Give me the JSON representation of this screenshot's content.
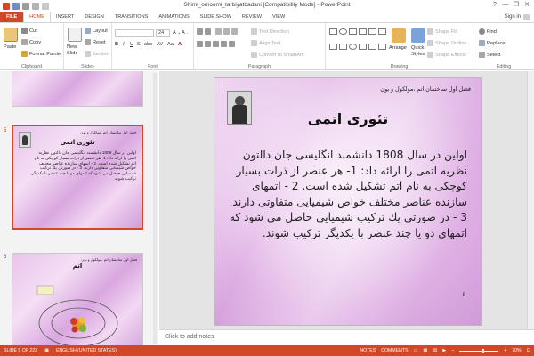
{
  "window": {
    "title": "Shimi_omoomi_tarbiyatbadani [Compatibility Mode] - PowerPoint",
    "minimize": "—",
    "restore": "❐",
    "close": "✕",
    "help": "?"
  },
  "tabs": [
    {
      "label": "FILE"
    },
    {
      "label": "HOME"
    },
    {
      "label": "INSERT"
    },
    {
      "label": "DESIGN"
    },
    {
      "label": "TRANSITIONS"
    },
    {
      "label": "ANIMATIONS"
    },
    {
      "label": "SLIDE SHOW"
    },
    {
      "label": "REVIEW"
    },
    {
      "label": "VIEW"
    }
  ],
  "account": {
    "signin": "Sign in"
  },
  "ribbon": {
    "clipboard": {
      "paste": "Paste",
      "cut": "Cut",
      "copy": "Copy",
      "format_painter": "Format Painter",
      "label": "Clipboard"
    },
    "slides": {
      "new_slide": "New",
      "new_slide2": "Slide",
      "layout": "Layout",
      "reset": "Reset",
      "section": "Section",
      "label": "Slides"
    },
    "font": {
      "size": "24",
      "bold": "B",
      "italic": "I",
      "underline": "U",
      "strike": "S",
      "abc": "abc",
      "av": "AV",
      "aa": "Aa",
      "fontcolor": "A",
      "label": "Font"
    },
    "paragraph": {
      "text_direction": "Text Direction",
      "align_text": "Align Text",
      "smartart": "Convert to SmartArt",
      "label": "Paragraph"
    },
    "drawing": {
      "arrange": "Arrange",
      "quick_styles": "Quick",
      "quick_styles2": "Styles",
      "shape_fill": "Shape Fill",
      "shape_outline": "Shape Outline",
      "shape_effects": "Shape Effects",
      "label": "Drawing"
    },
    "editing": {
      "find": "Find",
      "replace": "Replace",
      "select": "Select",
      "label": "Editing"
    }
  },
  "thumbnails": [
    {
      "number": "",
      "partial": true
    },
    {
      "number": "5",
      "header": "فصل اول ساختمان اتم ،مولکول و یون",
      "title": "تئوری اتمی",
      "body": "اولین در سال 1808 دانشمند انگلیسی جان دالتون نظریه اتمی را ارائه داد: 1- هر عنصر از ذرات بسیار کوچکی به نام اتم تشکیل شده است. 2 - اتمهای سازنده عناصر مختلف خواص شیمیایی متفاوتی دارند. 3 - در صورتی یك تركیب شیمیایی حاصل می شود كه اتمهای دو یا چند عنصر با یكدیگر تركیب شوند."
    },
    {
      "number": "6",
      "header": "فصل اول ساختمان اتم ،مولکول و یون",
      "title": "اتم"
    }
  ],
  "slide": {
    "header": "فصل اول ساختمان اتم ،مولکول و یون",
    "title": "تئوری اتمی",
    "body": "اولین در سال 1808 دانشمند انگلیسی جان دالتون نظریه اتمی را ارائه داد: 1- هر عنصر از ذرات بسیار كوچكی به نام اتم تشكیل شده است. 2 - اتمهای سازنده عناصر مختلف خواص شیمیایی متفاوتی دارند. 3 - در صورتی یك تركیب شیمیایی حاصل می شود كه اتمهای دو یا چند عنصر با یكدیگر تركیب شوند.",
    "page_number": "5"
  },
  "notes": {
    "placeholder": "Click to add notes"
  },
  "status": {
    "slide_info": "SLIDE 5 OF 223",
    "language": "ENGLISH (UNITED STATES)",
    "notes": "NOTES",
    "comments": "COMMENTS",
    "zoom": "70%"
  },
  "colors": {
    "accent": "#d24726"
  }
}
